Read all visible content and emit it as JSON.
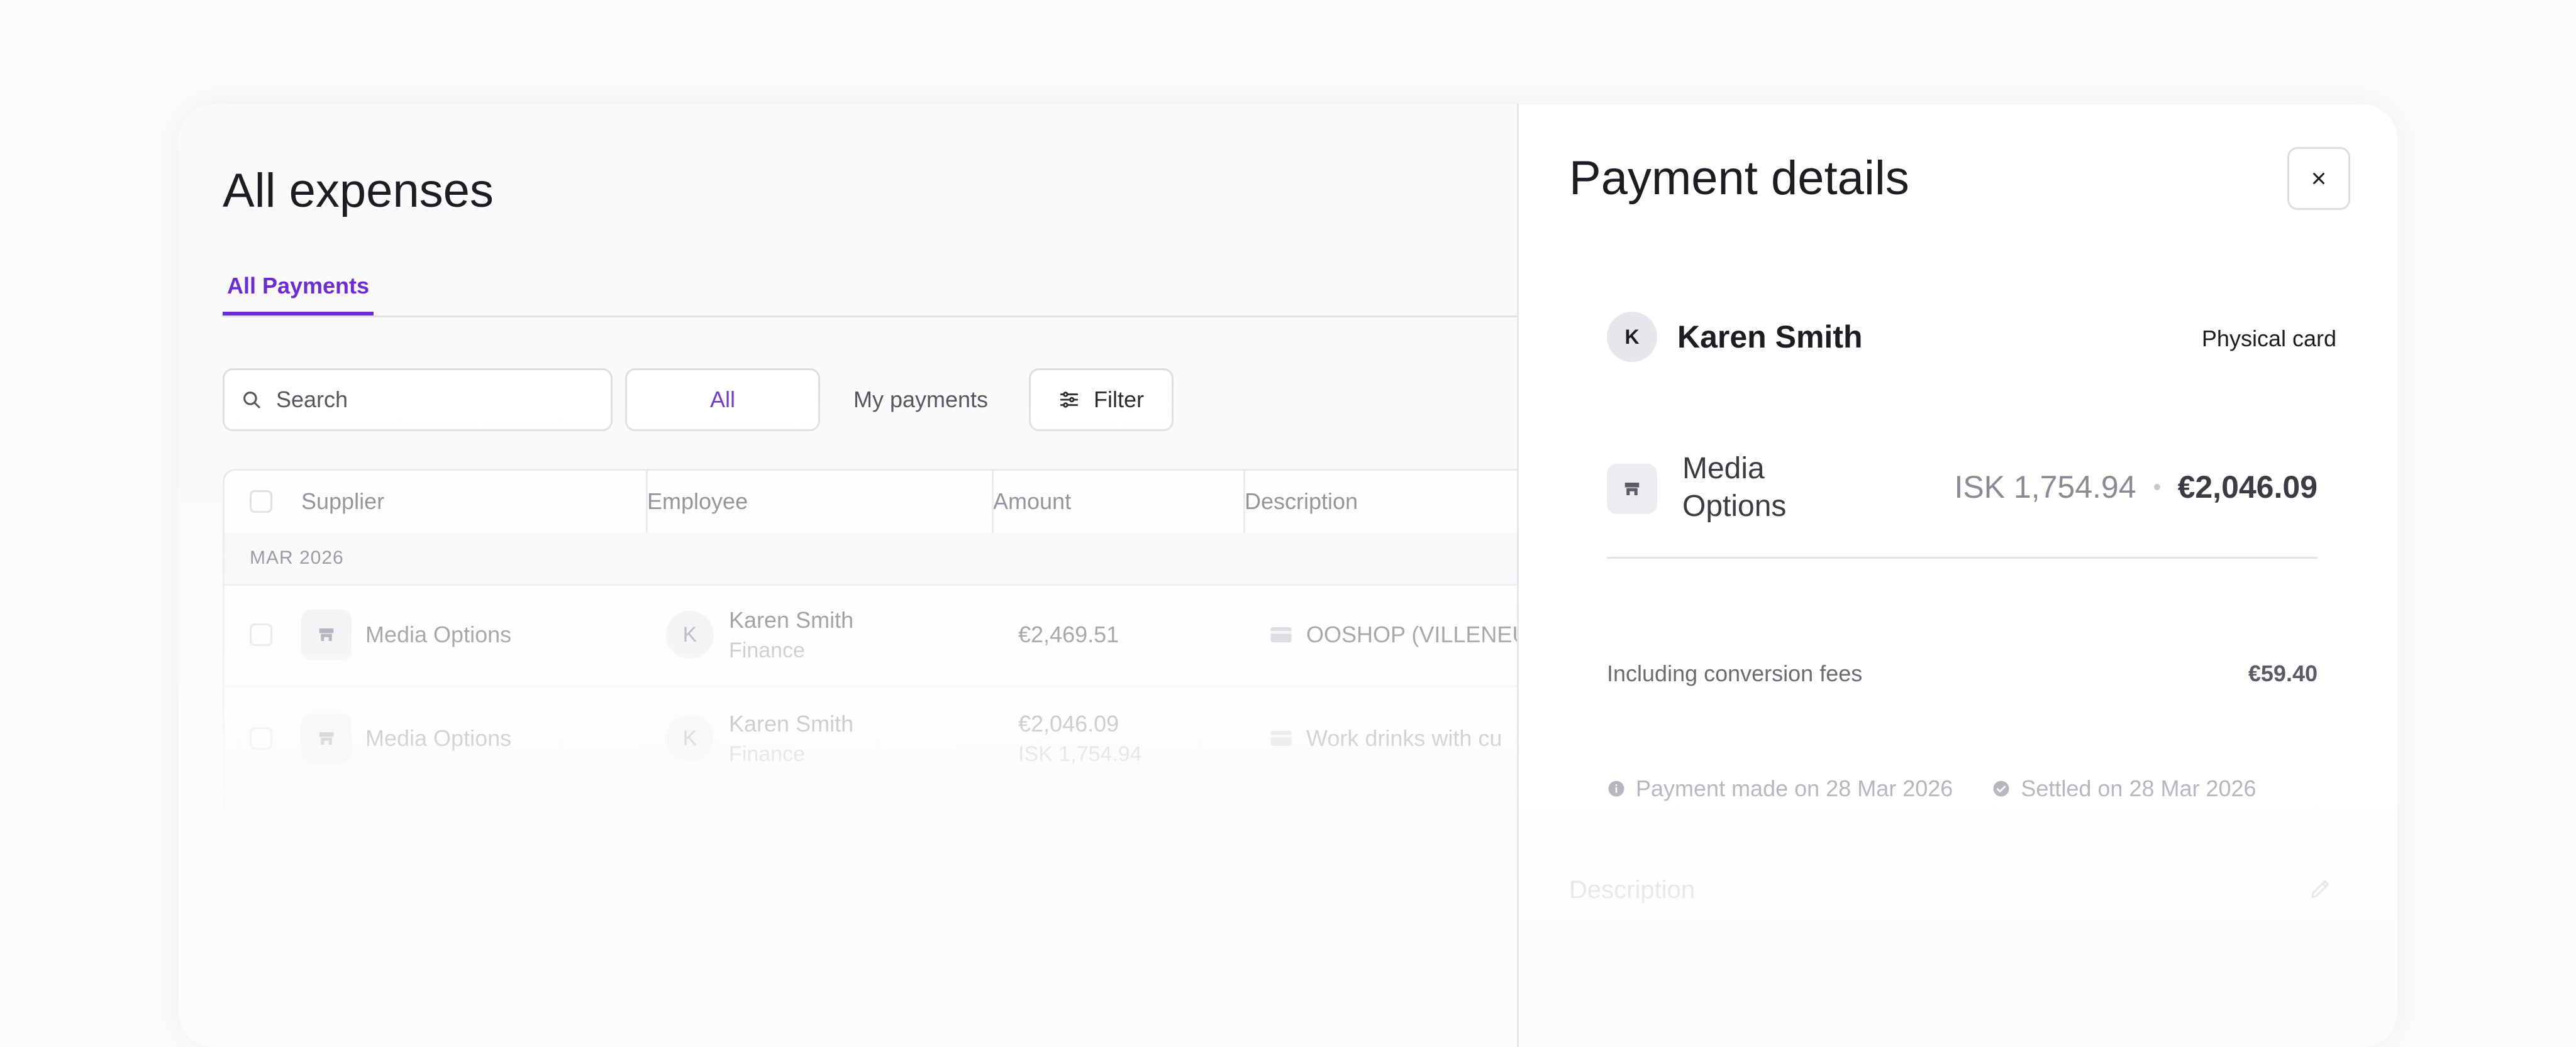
{
  "expenses": {
    "title": "All expenses",
    "tabs": [
      {
        "label": "All Payments",
        "active": true
      }
    ],
    "search": {
      "placeholder": "Search"
    },
    "segments": {
      "all": "All",
      "mine": "My payments"
    },
    "filter_label": "Filter",
    "table": {
      "headers": {
        "supplier": "Supplier",
        "employee": "Employee",
        "amount": "Amount",
        "description": "Description"
      },
      "group_label": "MAR 2026",
      "rows": [
        {
          "supplier": "Media Options",
          "employee": "Karen Smith",
          "department": "Finance",
          "avatar_initial": "K",
          "amount": "€2,469.51",
          "amount_secondary": "",
          "description": "OOSHOP (VILLENEU"
        },
        {
          "supplier": "Media Options",
          "employee": "Karen Smith",
          "department": "Finance",
          "avatar_initial": "K",
          "amount": "€2,046.09",
          "amount_secondary": "ISK 1,754.94",
          "description": "Work drinks with cu"
        }
      ]
    }
  },
  "details": {
    "title": "Payment details",
    "employee": {
      "initial": "K",
      "name": "Karen Smith"
    },
    "card_type": "Physical card",
    "merchant": {
      "name": "Media Options",
      "original_amount": "ISK 1,754.94",
      "amount": "€2,046.09"
    },
    "fees": {
      "label": "Including conversion fees",
      "value": "€59.40"
    },
    "payment_made": "Payment made on 28 Mar 2026",
    "settled": "Settled on 28 Mar 2026",
    "description_label": "Description"
  },
  "colors": {
    "accent": "#6a2cd6"
  }
}
